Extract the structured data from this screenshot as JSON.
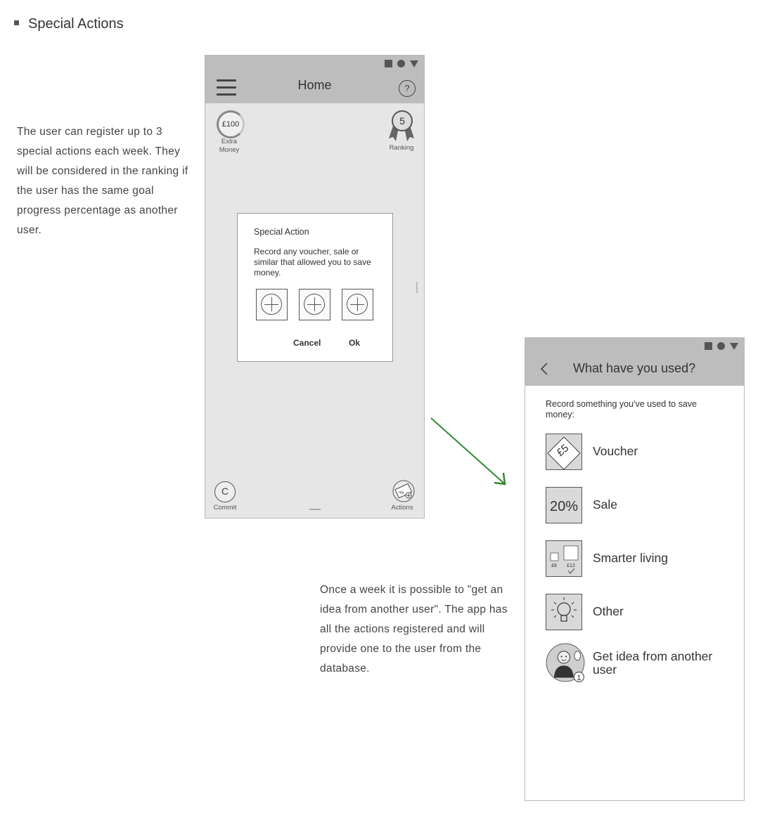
{
  "section": {
    "title": "Special Actions"
  },
  "notes": {
    "left": "The user can register up to 3 special actions each week. They will be considered in the ranking if the user has the same goal progress percentage as another user.",
    "bottom": "Once a week it is possible to \"get an idea from another user\". The app has all the actions registered and will provide one to the user from the database."
  },
  "home_screen": {
    "title": "Home",
    "help_glyph": "?",
    "extra_money": {
      "amount": "£100",
      "label_line1": "Extra",
      "label_line2": "Money"
    },
    "ranking": {
      "value": "5",
      "label": "Ranking"
    },
    "commit": {
      "glyph": "C",
      "label": "Commit"
    },
    "actions": {
      "label": "Actions"
    },
    "dialog": {
      "title": "Special Action",
      "text": "Record any voucher, sale or similar that allowed you to save money.",
      "cancel_label": "Cancel",
      "ok_label": "Ok"
    }
  },
  "used_screen": {
    "title": "What have you used?",
    "prompt": "Record something you've used to save money:",
    "options": [
      {
        "label": "Voucher",
        "icon": "voucher-icon",
        "icon_text": "£5"
      },
      {
        "label": "Sale",
        "icon": "sale-icon",
        "icon_text": "20%"
      },
      {
        "label": "Smarter living",
        "icon": "smarter-living-icon",
        "icon_text_a": "£8",
        "icon_text_b": "£12"
      },
      {
        "label": "Other",
        "icon": "lightbulb-icon"
      },
      {
        "label": "Get idea from another user",
        "icon": "user-idea-icon",
        "badge": "1"
      }
    ]
  },
  "colors": {
    "arrow": "#2e8b2e",
    "topbar": "#bdbdbd",
    "screen_bg": "#e6e6e6"
  }
}
